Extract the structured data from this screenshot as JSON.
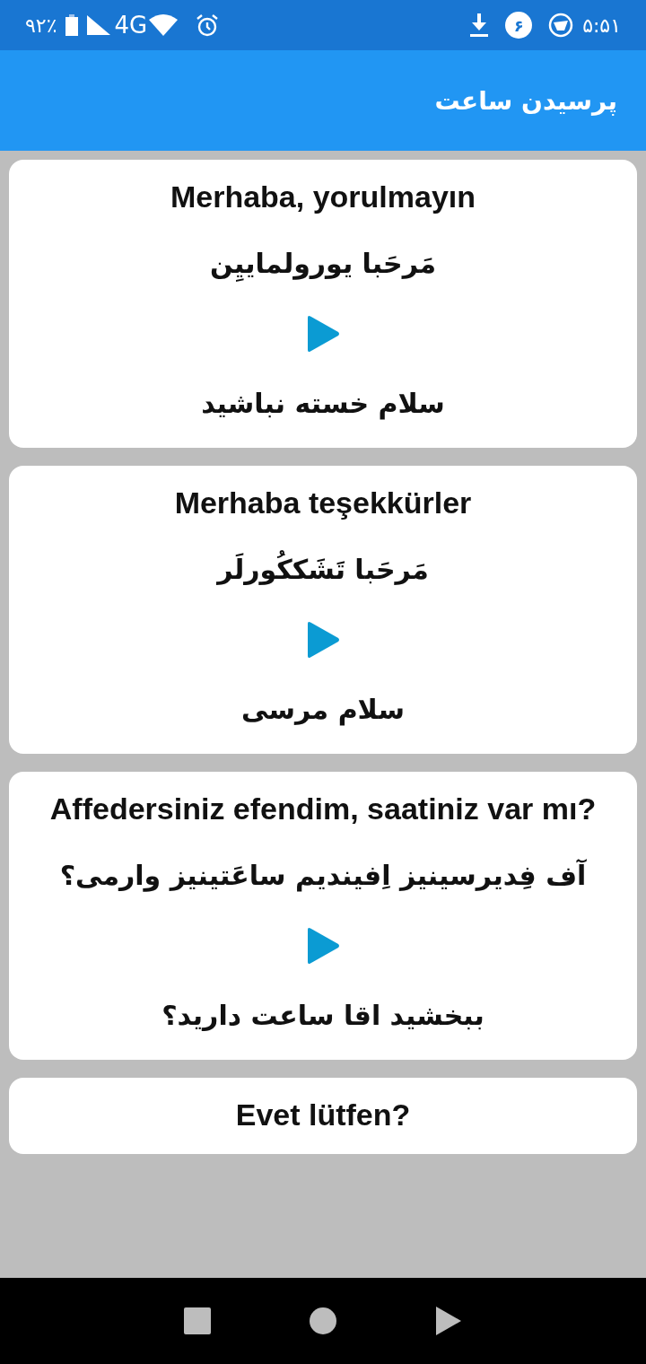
{
  "status_bar": {
    "battery": "۹۲٪",
    "network": "4G",
    "notification_count": "۶",
    "time": "۵:۵۱"
  },
  "app_bar": {
    "title": "پرسیدن ساعت"
  },
  "phrases": [
    {
      "turkish": "Merhaba, yorulmayın",
      "pronunciation": "مَرحَبا یورولماییِن",
      "persian": "سلام خسته نباشید"
    },
    {
      "turkish": "Merhaba teşekkürler",
      "pronunciation": "مَرحَبا تَشَککُورلَر",
      "persian": "سلام مرسی"
    },
    {
      "turkish": "Affedersiniz efendim, saatiniz var mı?",
      "pronunciation": "آف فِدیرسینیز اِفیندیم ساعَتینیز وارمی؟",
      "persian": "ببخشید اقا ساعت دارید؟"
    },
    {
      "turkish": "Evet lütfen?"
    }
  ]
}
